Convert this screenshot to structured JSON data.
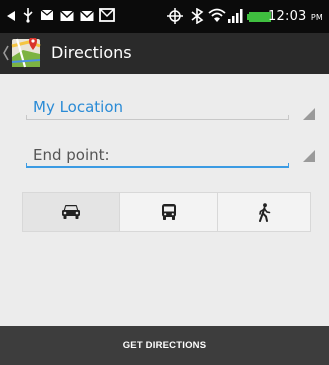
{
  "status_bar": {
    "time": "12:03",
    "ampm": "PM",
    "icons": [
      "notification-icon",
      "usb-icon",
      "mail-icon",
      "gmail-icon",
      "message-icon",
      "gps-icon",
      "bluetooth-icon",
      "wifi-icon",
      "signal-icon",
      "battery-icon"
    ],
    "battery_color": "#3fbf3f"
  },
  "action_bar": {
    "title": "Directions",
    "icon": "maps-app-icon"
  },
  "form": {
    "start_value": "My Location",
    "end_placeholder": "End point:",
    "accent_color": "#2a8bd6"
  },
  "modes": [
    {
      "name": "car",
      "icon": "car-icon",
      "selected": true
    },
    {
      "name": "transit",
      "icon": "bus-icon",
      "selected": false
    },
    {
      "name": "walk",
      "icon": "walk-icon",
      "selected": false
    }
  ],
  "actions": {
    "get_directions_label": "GET DIRECTIONS"
  }
}
